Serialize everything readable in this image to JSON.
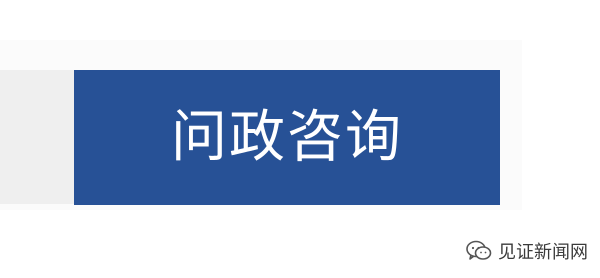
{
  "nav": {
    "button_label": "问政咨询"
  },
  "watermark": {
    "icon": "wechat-icon",
    "text": "见证新闻网"
  },
  "colors": {
    "button_bg": "#275196",
    "button_text": "#ffffff",
    "left_strip": "#efefef"
  }
}
